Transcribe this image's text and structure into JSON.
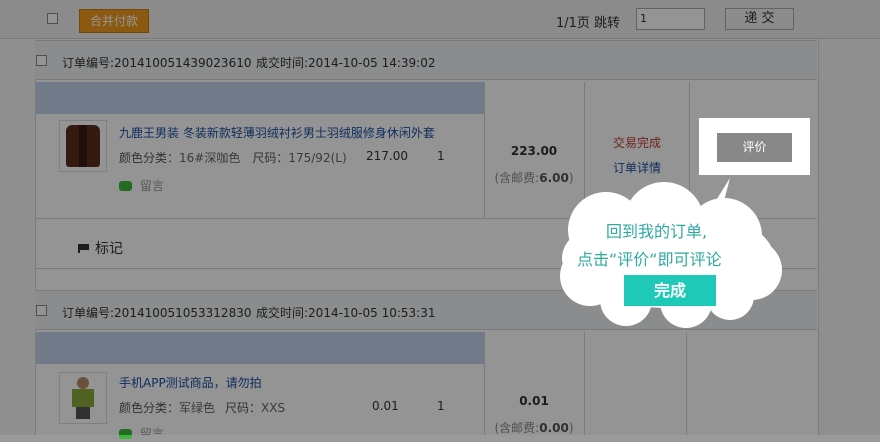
{
  "toolbar": {
    "merge_pay_label": "合并付款",
    "page_info": "1/1页 跳转",
    "jump_value": "1",
    "submit_label": "递 交"
  },
  "orders": [
    {
      "order_no": "订单编号:20141005143902361 0",
      "deal_time": "成交时间:2014-10-05 14:39:02",
      "item_title": "九鹿王男装 冬装新款轻薄羽绒衬衫男士羽绒服修身休闲外套",
      "color_label": "颜色分类：",
      "color_value": "16#深咖色",
      "size_label": "尺码：",
      "size_value": "175/92(L)",
      "unit_price": "217.00",
      "qty": "1",
      "message": "留言",
      "total": "223.00",
      "shipping": "(含邮费:6.00)",
      "status": "交易完成",
      "detail_link": "订单详情",
      "rate_label": "评价"
    },
    {
      "order_no": "订单编号:201410051053312830",
      "deal_time": "成交时间:2014-10-05 10:53:31",
      "item_title": "手机APP测试商品，请勿拍",
      "color_label": "颜色分类：",
      "color_value": "军绿色",
      "size_label": "尺码：",
      "size_value": "XXS",
      "unit_price": "0.01",
      "qty": "1",
      "message": "留言",
      "total": "0.01",
      "shipping": "(含邮费:0.00)"
    }
  ],
  "mark_label": "标记",
  "tooltip": {
    "line1": "回到我的订单,",
    "line2": "点击“评价“即可评论",
    "done_label": "完成"
  },
  "icons": [
    "checkbox-icon",
    "chat-bubble-icon",
    "flag-icon"
  ]
}
